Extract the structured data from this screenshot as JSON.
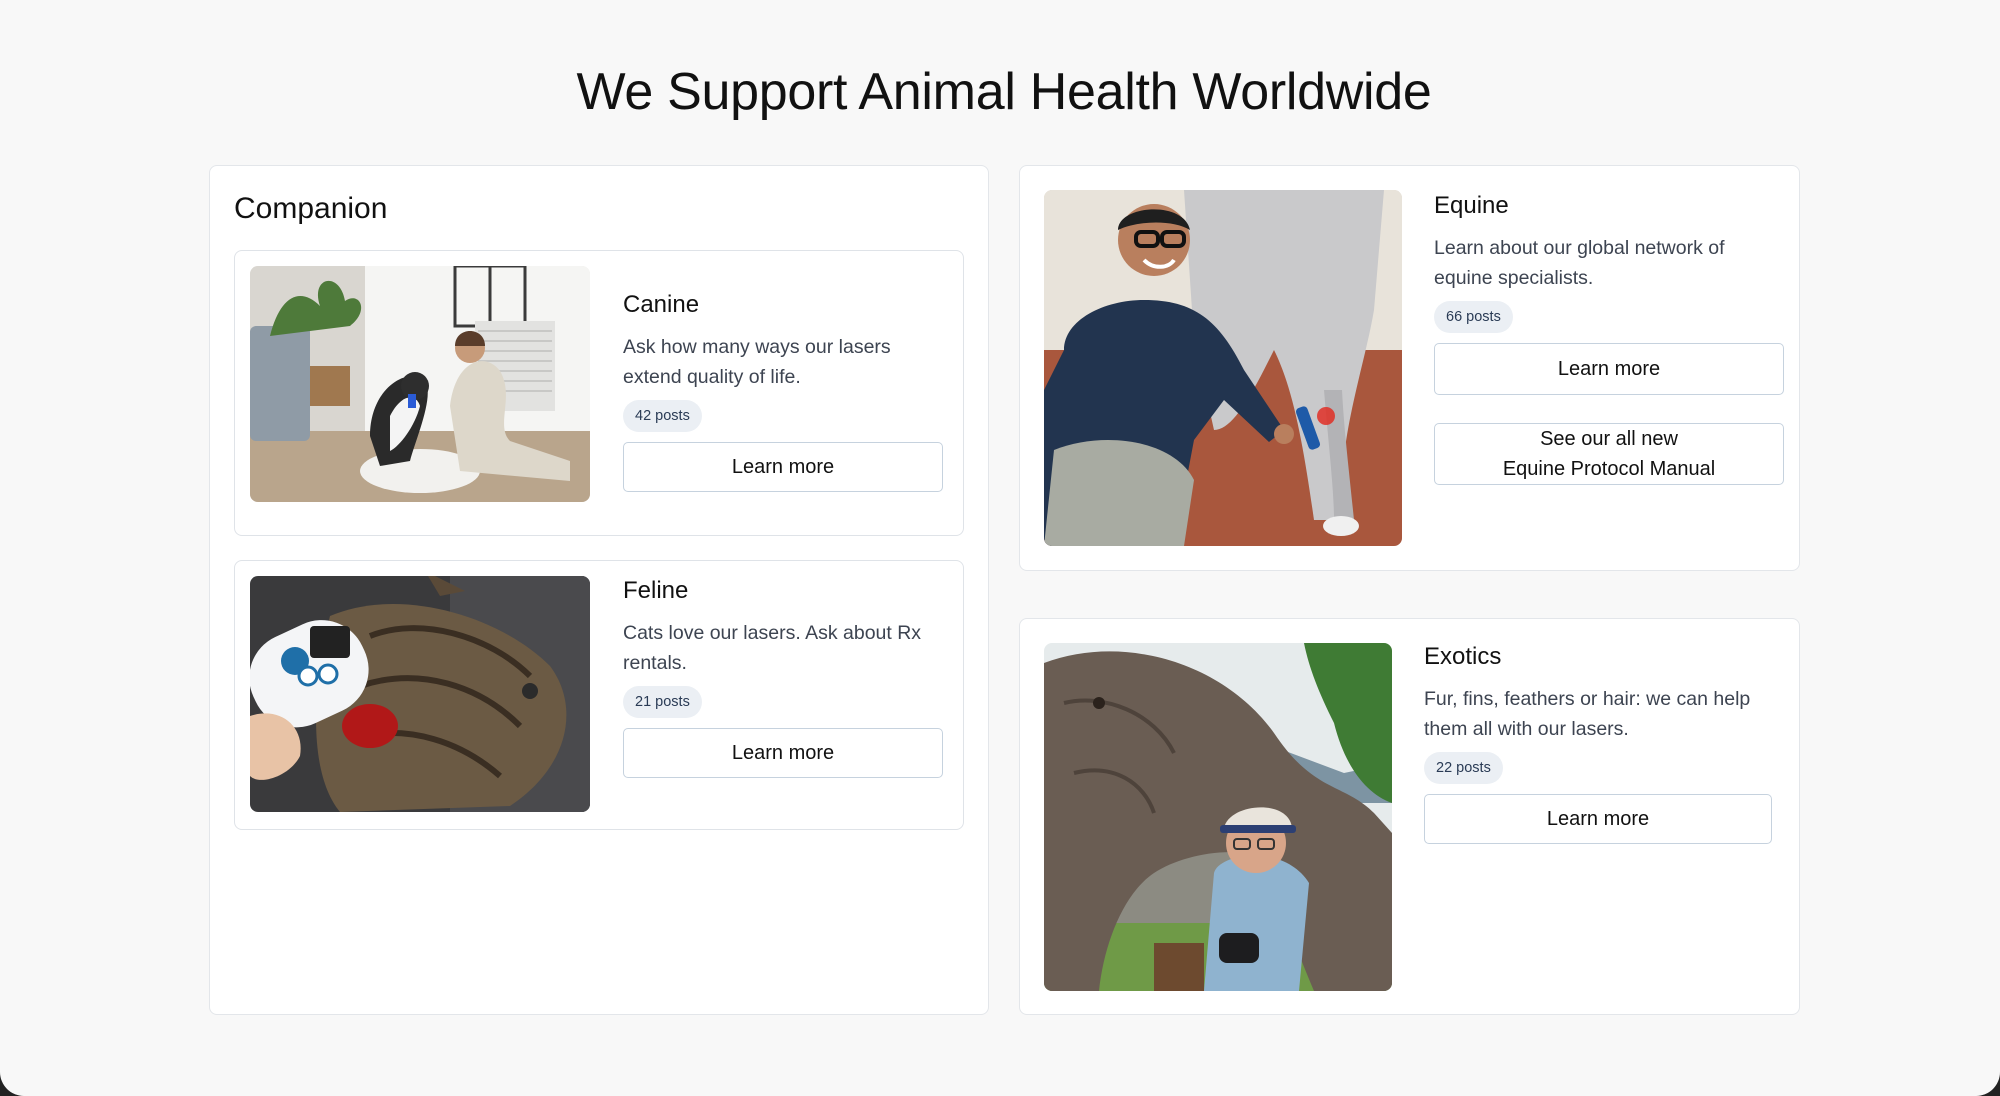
{
  "heading": "We Support Animal Health Worldwide",
  "companion": {
    "title": "Companion",
    "cards": [
      {
        "title": "Canine",
        "description": "Ask how many ways our lasers extend quality of life.",
        "badge": "42 posts",
        "button": "Learn more",
        "image": "woman-with-husky-photo"
      },
      {
        "title": "Feline",
        "description": "Cats love our lasers. Ask about Rx rentals.",
        "badge": "21 posts",
        "button": "Learn more",
        "image": "cat-laser-therapy-photo"
      }
    ]
  },
  "equine": {
    "title": "Equine",
    "description": "Learn about our global network of equine specialists.",
    "badge": "66 posts",
    "button": "Learn more",
    "manual_button_line1": "See our all new",
    "manual_button_line2": "Equine Protocol Manual",
    "image": "man-treating-horse-leg-photo"
  },
  "exotics": {
    "title": "Exotics",
    "description": "Fur, fins, feathers or hair: we can help them all with our lasers.",
    "badge": "22 posts",
    "button": "Learn more",
    "image": "man-with-elephant-photo"
  },
  "colors": {
    "page_background": "#f8f8f8",
    "card_border": "#dfe3e8",
    "badge_background": "#ebeff4",
    "button_border": "#c6d2de"
  }
}
